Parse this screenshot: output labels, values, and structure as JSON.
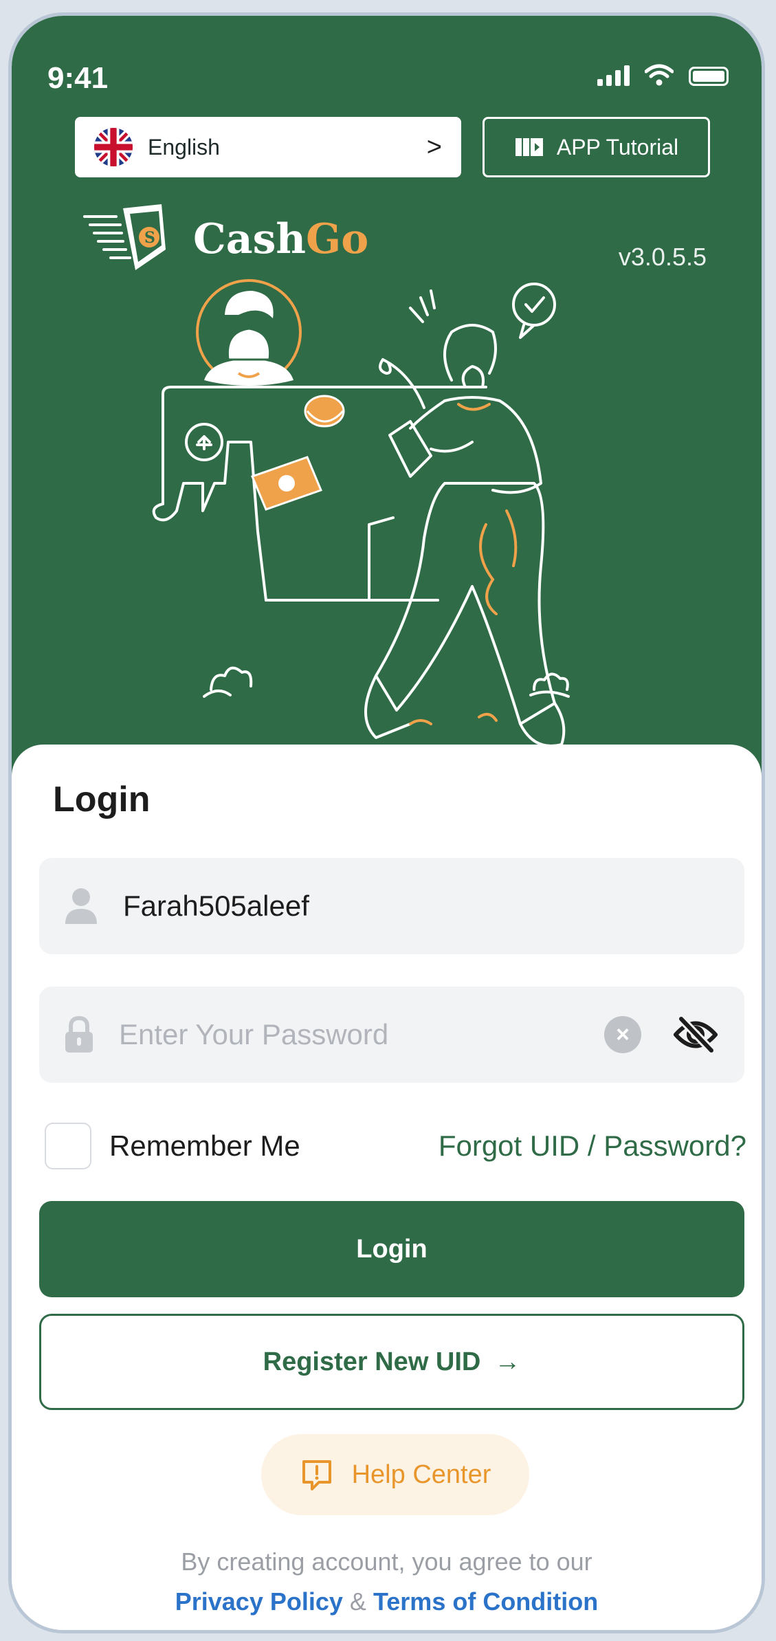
{
  "status": {
    "time": "9:41"
  },
  "header": {
    "language": "English",
    "language_chevron": ">",
    "tutorial_label": "APP Tutorial",
    "brand_part1": "Cash",
    "brand_part2": "Go",
    "version": "v3.0.5.5"
  },
  "login": {
    "title": "Login",
    "username_value": "Farah505aleef",
    "password_placeholder": "Enter Your Password",
    "remember_label": "Remember Me",
    "forgot_label": "Forgot UID / Password?",
    "login_button": "Login",
    "register_button": "Register New UID",
    "register_arrow": "→",
    "help_label": "Help Center"
  },
  "footer": {
    "agreement_text": "By creating account, you agree to our",
    "privacy_link": "Privacy Policy",
    "ampersand": "&",
    "terms_link": "Terms of Condition"
  },
  "colors": {
    "brand_green": "#2f6b47",
    "accent_orange": "#f0a24a",
    "link_blue": "#2b72c9"
  }
}
